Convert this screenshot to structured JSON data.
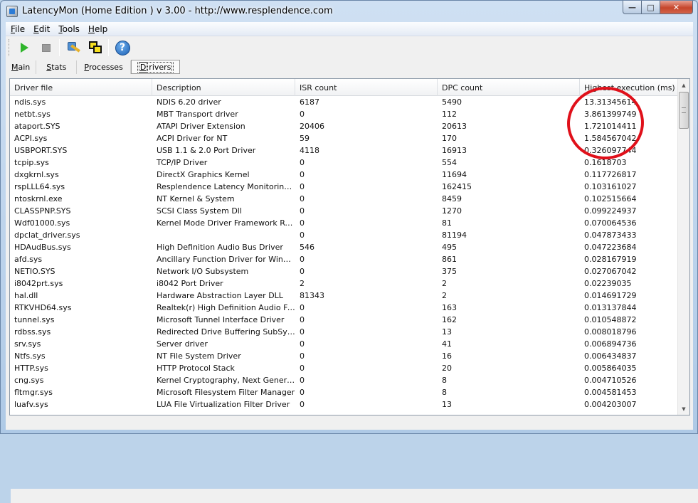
{
  "window": {
    "title": "LatencyMon  (Home Edition )  v 3.00 - http://www.resplendence.com"
  },
  "menu": [
    {
      "key": "F",
      "rest": "ile"
    },
    {
      "key": "E",
      "rest": "dit"
    },
    {
      "key": "T",
      "rest": "ools"
    },
    {
      "key": "H",
      "rest": "elp"
    }
  ],
  "toolbar": {
    "icons": [
      "start-icon",
      "stop-icon",
      "tools-icon",
      "windows-icon",
      "help-icon"
    ],
    "help_glyph": "?"
  },
  "tabs": [
    {
      "key": "M",
      "rest": "ain"
    },
    {
      "key": "S",
      "rest": "tats"
    },
    {
      "key": "P",
      "rest": "rocesses"
    },
    {
      "key": "D",
      "rest": "rivers"
    }
  ],
  "table": {
    "columns": [
      "Driver file",
      "Description",
      "ISR count",
      "DPC count",
      "Highest execution (ms)"
    ],
    "rows": [
      [
        "ndis.sys",
        "NDIS 6.20 driver",
        "6187",
        "5490",
        "13.31345614"
      ],
      [
        "netbt.sys",
        "MBT Transport driver",
        "0",
        "112",
        "3.861399749"
      ],
      [
        "ataport.SYS",
        "ATAPI Driver Extension",
        "20406",
        "20613",
        "1.721014411"
      ],
      [
        "ACPI.sys",
        "ACPI Driver for NT",
        "59",
        "170",
        "1.584567042"
      ],
      [
        "USBPORT.SYS",
        "USB 1.1 & 2.0 Port Driver",
        "4118",
        "16913",
        "0.326097744"
      ],
      [
        "tcpip.sys",
        "TCP/IP Driver",
        "0",
        "554",
        "0.1618703"
      ],
      [
        "dxgkrnl.sys",
        "DirectX Graphics Kernel",
        "0",
        "11694",
        "0.117726817"
      ],
      [
        "rspLLL64.sys",
        "Resplendence Latency Monitoring a...",
        "0",
        "162415",
        "0.103161027"
      ],
      [
        "ntoskrnl.exe",
        "NT Kernel & System",
        "0",
        "8459",
        "0.102515664"
      ],
      [
        "CLASSPNP.SYS",
        "SCSI Class System Dll",
        "0",
        "1270",
        "0.099224937"
      ],
      [
        "Wdf01000.sys",
        "Kernel Mode Driver Framework Runt...",
        "0",
        "81",
        "0.070064536"
      ],
      [
        "dpclat_driver.sys",
        "",
        "0",
        "81194",
        "0.047873433"
      ],
      [
        "HDAudBus.sys",
        "High Definition Audio Bus Driver",
        "546",
        "495",
        "0.047223684"
      ],
      [
        "afd.sys",
        "Ancillary Function Driver for WinSock",
        "0",
        "861",
        "0.028167919"
      ],
      [
        "NETIO.SYS",
        "Network I/O Subsystem",
        "0",
        "375",
        "0.027067042"
      ],
      [
        "i8042prt.sys",
        "i8042 Port Driver",
        "2",
        "2",
        "0.02239035"
      ],
      [
        "hal.dll",
        "Hardware Abstraction Layer DLL",
        "81343",
        "2",
        "0.014691729"
      ],
      [
        "RTKVHD64.sys",
        "Realtek(r) High Definition Audio Fun...",
        "0",
        "163",
        "0.013137844"
      ],
      [
        "tunnel.sys",
        "Microsoft Tunnel Interface Driver",
        "0",
        "162",
        "0.010548872"
      ],
      [
        "rdbss.sys",
        "Redirected Drive Buffering SubSyst...",
        "0",
        "13",
        "0.008018796"
      ],
      [
        "srv.sys",
        "Server driver",
        "0",
        "41",
        "0.006894736"
      ],
      [
        "Ntfs.sys",
        "NT File System Driver",
        "0",
        "16",
        "0.006434837"
      ],
      [
        "HTTP.sys",
        "HTTP Protocol Stack",
        "0",
        "20",
        "0.005864035"
      ],
      [
        "cng.sys",
        "Kernel Cryptography, Next Generation",
        "0",
        "8",
        "0.004710526"
      ],
      [
        "fltmgr.sys",
        "Microsoft Filesystem Filter Manager",
        "0",
        "8",
        "0.004581453"
      ],
      [
        "luafv.sys",
        "LUA File Virtualization Filter Driver",
        "0",
        "13",
        "0.004203007"
      ]
    ]
  },
  "colors": {
    "annotation_circle": "#e0101a",
    "play_green": "#2fb52b"
  }
}
